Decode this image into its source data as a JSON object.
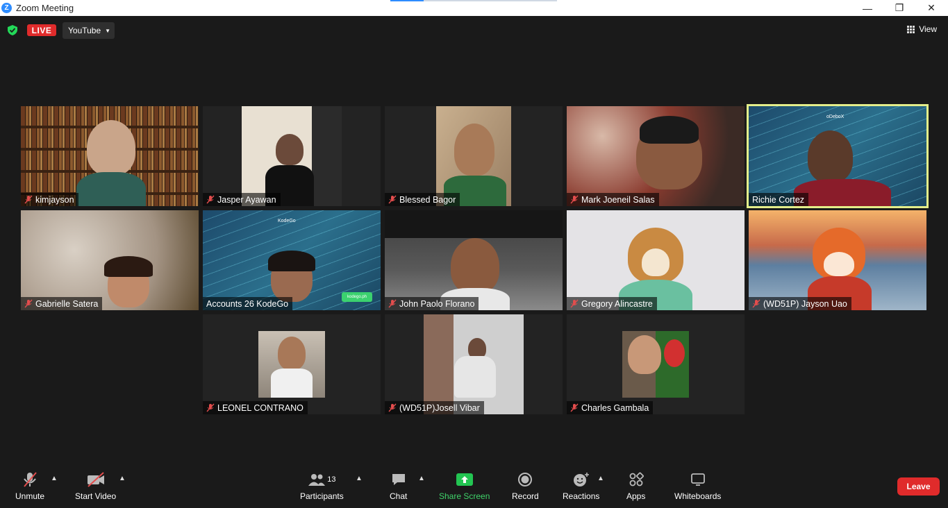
{
  "window": {
    "title": "Zoom Meeting",
    "minimize": "—",
    "maximize": "❐",
    "close": "✕"
  },
  "topbar": {
    "live_label": "LIVE",
    "stream_target": "YouTube",
    "view_label": "View"
  },
  "participants": [
    {
      "name": "kimjayson",
      "muted": true
    },
    {
      "name": "Jasper Ayawan",
      "muted": true
    },
    {
      "name": "Blessed Bagor",
      "muted": true
    },
    {
      "name": "Mark Joeneil Salas",
      "muted": true
    },
    {
      "name": "Richie Cortez",
      "muted": false,
      "speaking": true
    },
    {
      "name": "Gabrielle Satera",
      "muted": true
    },
    {
      "name": "Accounts 26 KodeGo",
      "muted": false
    },
    {
      "name": "John Paolo Florano",
      "muted": true
    },
    {
      "name": "Gregory Alincastre",
      "muted": true
    },
    {
      "name": "(WD51P) Jayson Uao",
      "muted": true
    },
    {
      "name": "LEONEL CONTRANO",
      "muted": true
    },
    {
      "name": "(WD51P)Josell Vibar",
      "muted": true
    },
    {
      "name": "Charles Gambala",
      "muted": true
    }
  ],
  "tile_texts": {
    "kodebox": "oDeboX",
    "kodego": "KodeGo",
    "kodego_badge": "kodego.ph"
  },
  "toolbar": {
    "unmute": "Unmute",
    "start_video": "Start Video",
    "participants": "Participants",
    "participant_count": "13",
    "chat": "Chat",
    "share_screen": "Share Screen",
    "record": "Record",
    "reactions": "Reactions",
    "apps": "Apps",
    "whiteboards": "Whiteboards",
    "leave": "Leave"
  },
  "colors": {
    "accent": "#2d8cff",
    "live": "#e02b2b",
    "share": "#3fd36a",
    "speaking_border": "#e4ee8a"
  }
}
